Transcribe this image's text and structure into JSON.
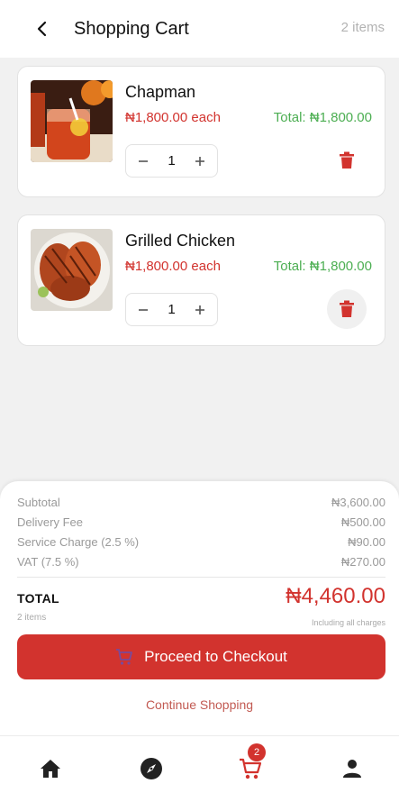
{
  "header": {
    "title": "Shopping Cart",
    "item_count": "2 items"
  },
  "items": [
    {
      "name": "Chapman",
      "price": "₦1,800.00 each",
      "total": "Total: ₦1,800.00",
      "quantity": "1"
    },
    {
      "name": "Grilled Chicken",
      "price": "₦1,800.00 each",
      "total": "Total: ₦1,800.00",
      "quantity": "1"
    }
  ],
  "summary": {
    "subtotal_label": "Subtotal",
    "subtotal_value": "₦3,600.00",
    "delivery_label": "Delivery Fee",
    "delivery_value": "₦500.00",
    "service_label": "Service Charge (2.5 %)",
    "service_value": "₦90.00",
    "vat_label": "VAT (7.5 %)",
    "vat_value": "₦270.00",
    "total_label": "TOTAL",
    "total_items": "2 items",
    "total_amount": "₦4,460.00",
    "total_note": "Including all charges"
  },
  "actions": {
    "checkout_label": "Proceed to Checkout",
    "continue_label": "Continue Shopping"
  },
  "nav": {
    "cart_badge": "2",
    "icons": [
      "home-icon",
      "compass-icon",
      "cart-icon",
      "person-icon"
    ]
  },
  "colors": {
    "accent": "#d2332e",
    "success": "#4cae52",
    "muted": "#9a9a9a"
  }
}
